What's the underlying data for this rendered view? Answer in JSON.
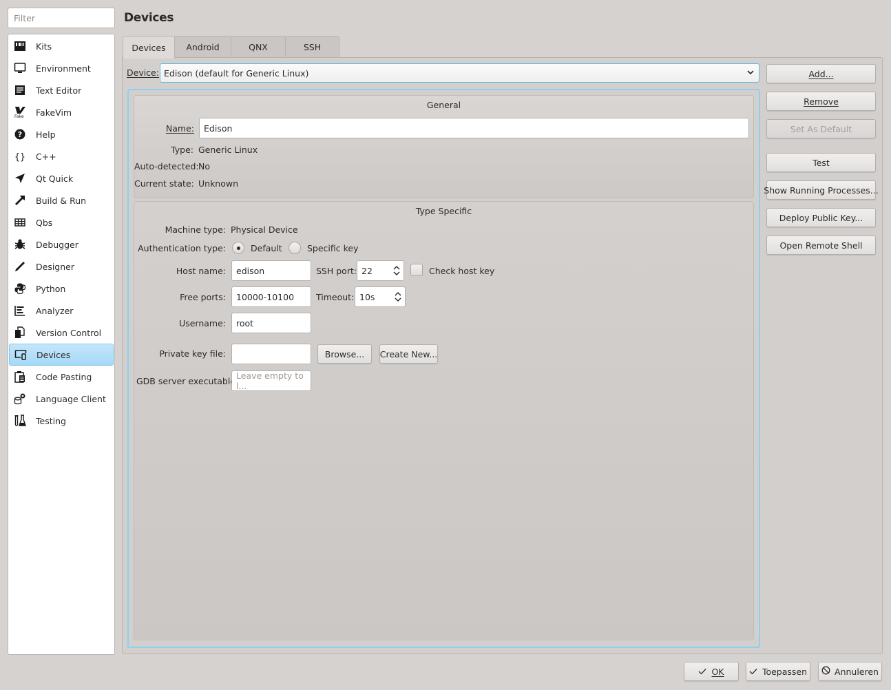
{
  "filter": {
    "placeholder": "Filter",
    "value": ""
  },
  "sidebar": {
    "items": [
      {
        "label": "Kits",
        "icon": "kits-icon"
      },
      {
        "label": "Environment",
        "icon": "monitor-icon"
      },
      {
        "label": "Text Editor",
        "icon": "text-editor-icon"
      },
      {
        "label": "FakeVim",
        "icon": "fakevim-icon"
      },
      {
        "label": "Help",
        "icon": "help-icon"
      },
      {
        "label": "C++",
        "icon": "braces-icon"
      },
      {
        "label": "Qt Quick",
        "icon": "qt-quick-icon"
      },
      {
        "label": "Build & Run",
        "icon": "hammer-icon"
      },
      {
        "label": "Qbs",
        "icon": "qbs-grid-icon"
      },
      {
        "label": "Debugger",
        "icon": "bug-icon"
      },
      {
        "label": "Designer",
        "icon": "pencil-icon"
      },
      {
        "label": "Python",
        "icon": "python-icon"
      },
      {
        "label": "Analyzer",
        "icon": "analyzer-icon"
      },
      {
        "label": "Version Control",
        "icon": "version-control-icon"
      },
      {
        "label": "Devices",
        "icon": "devices-icon",
        "selected": true
      },
      {
        "label": "Code Pasting",
        "icon": "clipboard-icon"
      },
      {
        "label": "Language Client",
        "icon": "language-client-icon"
      },
      {
        "label": "Testing",
        "icon": "testing-icon"
      }
    ]
  },
  "header": {
    "title": "Devices"
  },
  "tabs": [
    {
      "label": "Devices",
      "active": true
    },
    {
      "label": "Android"
    },
    {
      "label": "QNX"
    },
    {
      "label": "SSH"
    }
  ],
  "device": {
    "label": "Device:",
    "selected": "Edison (default for Generic Linux)"
  },
  "general": {
    "title": "General",
    "name_label": "Name:",
    "name_value": "Edison",
    "type_label": "Type:",
    "type_value": "Generic Linux",
    "auto_label": "Auto-detected:",
    "auto_value": "No",
    "state_label": "Current state:",
    "state_value": "Unknown"
  },
  "type_specific": {
    "title": "Type Specific",
    "machine_label": "Machine type:",
    "machine_value": "Physical Device",
    "auth_label": "Authentication type:",
    "auth_options": [
      {
        "label": "Default",
        "checked": true
      },
      {
        "label": "Specific key",
        "checked": false
      }
    ],
    "host_label": "Host name:",
    "host_value": "edison",
    "ssh_port_label": "SSH port:",
    "ssh_port_value": "22",
    "check_host_key_label": "Check host key",
    "check_host_key_checked": false,
    "free_ports_label": "Free ports:",
    "free_ports_value": "10000-10100",
    "timeout_label": "Timeout:",
    "timeout_value": "10s",
    "username_label": "Username:",
    "username_value": "root",
    "private_key_label": "Private key file:",
    "private_key_value": "",
    "browse_label": "Browse...",
    "create_new_label": "Create New...",
    "gdb_label": "GDB server executable:",
    "gdb_placeholder": "Leave empty to l..."
  },
  "actions": {
    "add": "Add...",
    "remove": "Remove",
    "set_default": "Set As Default",
    "test": "Test",
    "show_processes": "Show Running Processes...",
    "deploy_key": "Deploy Public Key...",
    "open_shell": "Open Remote Shell"
  },
  "footer": {
    "ok": "OK",
    "apply": "Toepassen",
    "cancel": "Annuleren"
  }
}
